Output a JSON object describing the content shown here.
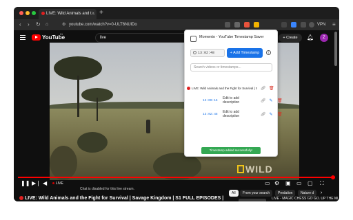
{
  "tab": {
    "title": "LIVE: Wild Animals and t...",
    "close": "×",
    "new_tab": "+"
  },
  "traffic_lights": [
    "#ff5f57",
    "#febc2e",
    "#28c840"
  ],
  "address_bar": {
    "url": "youtube.com/watch?v=0-ULT6NUlDo",
    "vpn": "VPN"
  },
  "youtube": {
    "brand": "YouTube",
    "country": "IN",
    "search_query": "live",
    "create_label": "Create",
    "avatar_letter": "Z"
  },
  "video": {
    "watermark": "WILD",
    "live_label": "LIVE",
    "progress": 1.0
  },
  "below": {
    "chat_disabled": "Chat is disabled for this live stream.",
    "chips": [
      "All",
      "From your search",
      "Predation",
      "Nature d"
    ],
    "title": "LIVE: Wild Animals and the Fight for Survival | Savage Kingdom | S1 FULL EPISODES |",
    "reco_title": "LIVE - MAGIC CHESS GO GO. UP THE MP GOOD MAIN"
  },
  "popup": {
    "title": "Momento - YouTube Timestamp Saver",
    "current_time": "13:02:48",
    "add_button": "+ Add Timestamp",
    "search_placeholder": "Search videos or timestamps...",
    "video_title": "LIVE: Wild Animals and the Fight for Survival | S...",
    "timestamps": [
      {
        "time": "13:00:16",
        "description": "Edit to add description"
      },
      {
        "time": "13:02:48",
        "description": "Edit to add description"
      }
    ],
    "toast": "Timestamp added successfully!"
  }
}
